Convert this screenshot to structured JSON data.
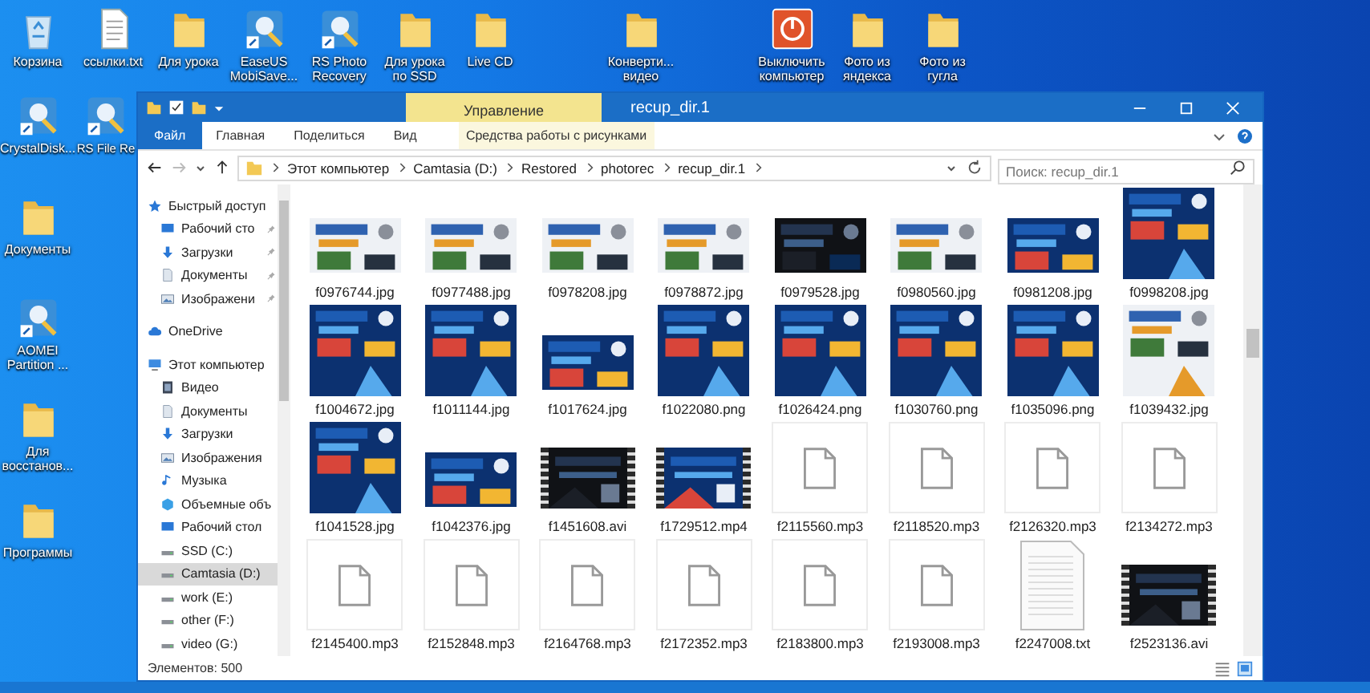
{
  "desktop": {
    "icons": [
      {
        "label": "Корзина",
        "kind": "recycle-bin"
      },
      {
        "label": "ссылки.txt",
        "kind": "text-file"
      },
      {
        "label": "Для урока",
        "kind": "folder"
      },
      {
        "label": "EaseUS MobiSave...",
        "kind": "app"
      },
      {
        "label": "RS Photo Recovery",
        "kind": "app"
      },
      {
        "label": "Для урока по SSD",
        "kind": "folder"
      },
      {
        "label": "Live CD",
        "kind": "folder"
      },
      {
        "label": "Конверти... видео",
        "kind": "folder"
      },
      {
        "label": "Выключить компьютер",
        "kind": "power"
      },
      {
        "label": "Фото из яндекса",
        "kind": "folder"
      },
      {
        "label": "Фото из гугла",
        "kind": "folder"
      }
    ],
    "side_rows": [
      {
        "icons": [
          {
            "label": "CrystalDisk...",
            "kind": "app"
          },
          {
            "label": "RS File Re",
            "kind": "app"
          }
        ]
      },
      {
        "icons": [
          {
            "label": "Документы",
            "kind": "folder"
          }
        ]
      },
      {
        "icons": [
          {
            "label": "AOMEI Partition ...",
            "kind": "app"
          }
        ]
      },
      {
        "icons": [
          {
            "label": "Для восстанов...",
            "kind": "folder"
          }
        ]
      },
      {
        "icons": [
          {
            "label": "Программы",
            "kind": "folder"
          }
        ]
      }
    ]
  },
  "window": {
    "context_tab": "Управление",
    "title": "recup_dir.1"
  },
  "ribbon": {
    "tabs": [
      {
        "label": "Файл",
        "kind": "file"
      },
      {
        "label": "Главная",
        "kind": "normal"
      },
      {
        "label": "Поделиться",
        "kind": "normal"
      },
      {
        "label": "Вид",
        "kind": "normal"
      },
      {
        "label": "Средства работы с рисунками",
        "kind": "context"
      }
    ]
  },
  "address": {
    "path": [
      "Этот компьютер",
      "Camtasia (D:)",
      "Restored",
      "photorec",
      "recup_dir.1"
    ],
    "search": {
      "placeholder": "Поиск: recup_dir.1"
    }
  },
  "sidebar": {
    "items": [
      {
        "label": "Быстрый доступ",
        "kind": "star",
        "selected": false,
        "children": [
          {
            "label": "Рабочий сто",
            "kind": "desktop",
            "selected": false,
            "pinned": true
          },
          {
            "label": "Загрузки",
            "kind": "download",
            "selected": false,
            "pinned": true
          },
          {
            "label": "Документы",
            "kind": "document",
            "selected": false,
            "pinned": true
          },
          {
            "label": "Изображени",
            "kind": "images",
            "selected": false,
            "pinned": true
          }
        ]
      },
      {
        "label": "OneDrive",
        "kind": "cloud",
        "selected": false
      },
      {
        "label": "Этот компьютер",
        "kind": "computer",
        "selected": false,
        "children": [
          {
            "label": "Видео",
            "kind": "video",
            "selected": false
          },
          {
            "label": "Документы",
            "kind": "document",
            "selected": false
          },
          {
            "label": "Загрузки",
            "kind": "download",
            "selected": false
          },
          {
            "label": "Изображения",
            "kind": "images",
            "selected": false
          },
          {
            "label": "Музыка",
            "kind": "music",
            "selected": false
          },
          {
            "label": "Объемные объ",
            "kind": "cube",
            "selected": false
          },
          {
            "label": "Рабочий стол",
            "kind": "desktop",
            "selected": false
          },
          {
            "label": "SSD (C:)",
            "kind": "drive",
            "selected": false
          },
          {
            "label": "Camtasia (D:)",
            "kind": "drive",
            "selected": true
          },
          {
            "label": "work (E:)",
            "kind": "drive",
            "selected": false
          },
          {
            "label": "other (F:)",
            "kind": "drive",
            "selected": false
          },
          {
            "label": "video (G:)",
            "kind": "drive",
            "selected": false
          }
        ]
      }
    ]
  },
  "files": [
    {
      "name": "f0976744.jpg"
    },
    {
      "name": "f0977488.jpg"
    },
    {
      "name": "f0978208.jpg"
    },
    {
      "name": "f0978872.jpg"
    },
    {
      "name": "f0979528.jpg"
    },
    {
      "name": "f0980560.jpg"
    },
    {
      "name": "f0981208.jpg"
    },
    {
      "name": "f0998208.jpg"
    },
    {
      "name": "f1004672.jpg"
    },
    {
      "name": "f1011144.jpg"
    },
    {
      "name": "f1017624.jpg"
    },
    {
      "name": "f1022080.png"
    },
    {
      "name": "f1026424.png"
    },
    {
      "name": "f1030760.png"
    },
    {
      "name": "f1035096.png"
    },
    {
      "name": "f1039432.jpg"
    },
    {
      "name": "f1041528.jpg"
    },
    {
      "name": "f1042376.jpg"
    },
    {
      "name": "f1451608.avi",
      "kind": "video"
    },
    {
      "name": "f1729512.mp4",
      "kind": "video"
    },
    {
      "name": "f2115560.mp3",
      "kind": "file"
    },
    {
      "name": "f2118520.mp3",
      "kind": "file"
    },
    {
      "name": "f2126320.mp3",
      "kind": "file"
    },
    {
      "name": "f2134272.mp3",
      "kind": "file"
    },
    {
      "name": "f2145400.mp3",
      "kind": "file"
    },
    {
      "name": "f2152848.mp3",
      "kind": "file"
    },
    {
      "name": "f2164768.mp3",
      "kind": "file"
    },
    {
      "name": "f2172352.mp3",
      "kind": "file"
    },
    {
      "name": "f2183800.mp3",
      "kind": "file"
    },
    {
      "name": "f2193008.mp3",
      "kind": "file"
    },
    {
      "name": "f2247008.txt",
      "kind": "text"
    },
    {
      "name": "f2523136.avi",
      "kind": "video"
    }
  ],
  "status_bar": {
    "count": "Элементов: 500"
  }
}
